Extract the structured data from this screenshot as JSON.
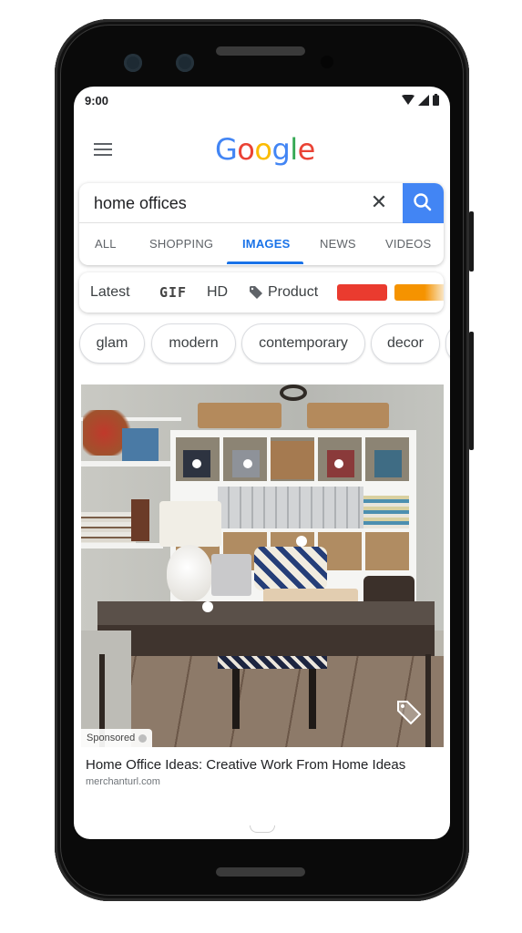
{
  "status_bar": {
    "time": "9:00",
    "icons": [
      "wifi-icon",
      "signal-icon",
      "battery-icon"
    ]
  },
  "header": {
    "menu_icon": "hamburger-menu-icon",
    "logo": {
      "letters": [
        "G",
        "o",
        "o",
        "g",
        "l",
        "e"
      ],
      "colors": [
        "#4285f4",
        "#ea4335",
        "#fbbc05",
        "#4285f4",
        "#34a853",
        "#ea4335"
      ]
    }
  },
  "search": {
    "query": "home offices",
    "clear_icon": "close-icon",
    "clear_glyph": "✕",
    "submit_icon": "search-icon",
    "accent_color": "#4285f4"
  },
  "tabs": [
    {
      "label": "ALL",
      "active": false
    },
    {
      "label": "SHOPPING",
      "active": false
    },
    {
      "label": "IMAGES",
      "active": true
    },
    {
      "label": "NEWS",
      "active": false
    },
    {
      "label": "VIDEOS",
      "active": false
    }
  ],
  "filters": {
    "items": [
      "Latest",
      "GIF",
      "HD",
      "Product"
    ],
    "product_icon": "tag-icon",
    "color_swatches": [
      "#ea3b2f",
      "#f59300"
    ]
  },
  "chips": [
    "glam",
    "modern",
    "contemporary",
    "decor"
  ],
  "result": {
    "image_alt": "Home office with white cube shelving, woven baskets, lamp, laptop and dark wooden desk",
    "sponsored_label": "Sponsored",
    "title": "Home Office Ideas: Creative Work From Home Ideas",
    "url": "merchanturl.com",
    "product_tag_icon": "product-tag-icon"
  }
}
